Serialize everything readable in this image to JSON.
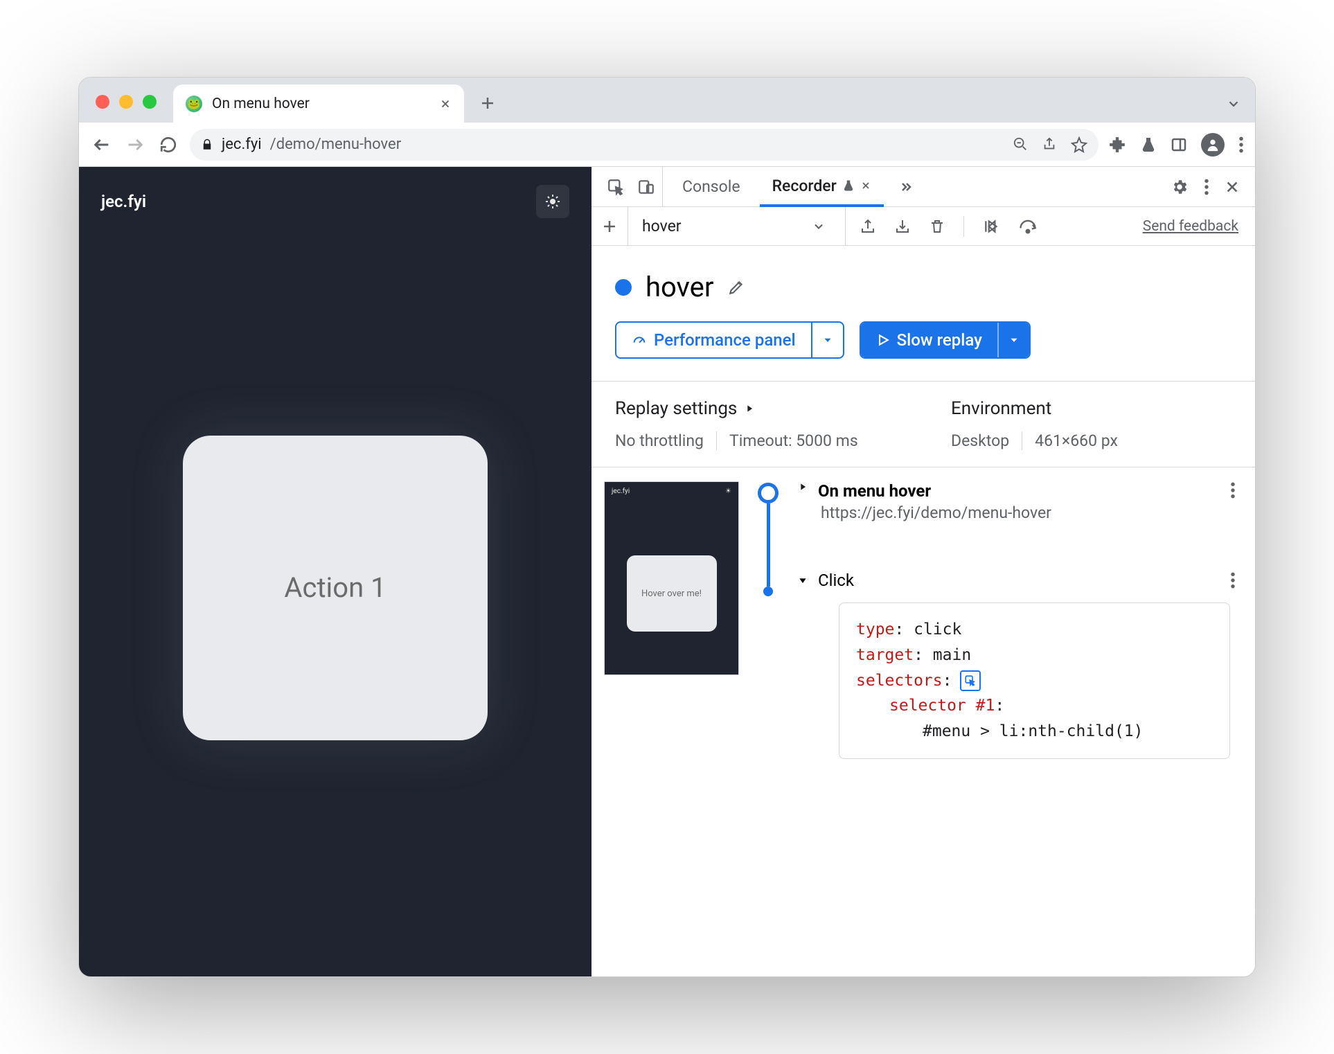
{
  "tab": {
    "title": "On menu hover"
  },
  "toolbar": {
    "host": "jec.fyi",
    "path": "/demo/menu-hover"
  },
  "page": {
    "brand": "jec.fyi",
    "card_text": "Action 1"
  },
  "devtools": {
    "tabs": {
      "console": "Console",
      "recorder": "Recorder"
    },
    "rec_toolbar": {
      "name": "hover",
      "feedback": "Send feedback"
    },
    "flow": {
      "name": "hover"
    },
    "buttons": {
      "performance": "Performance panel",
      "slow_replay": "Slow replay"
    },
    "settings": {
      "replay_head": "Replay settings",
      "throttling": "No throttling",
      "timeout": "Timeout: 5000 ms",
      "env_head": "Environment",
      "device": "Desktop",
      "viewport": "461×660 px"
    },
    "step0": {
      "title": "On menu hover",
      "url": "https://jec.fyi/demo/menu-hover"
    },
    "step1": {
      "title": "Click"
    },
    "code": {
      "type_k": "type",
      "type_v": "click",
      "target_k": "target",
      "target_v": "main",
      "selectors_k": "selectors",
      "selector_k": "selector",
      "selector_num": "#1",
      "selector_val": "#menu > li:nth-child(1)"
    },
    "thumb": {
      "brand": "jec.fyi",
      "card": "Hover over me!"
    }
  }
}
